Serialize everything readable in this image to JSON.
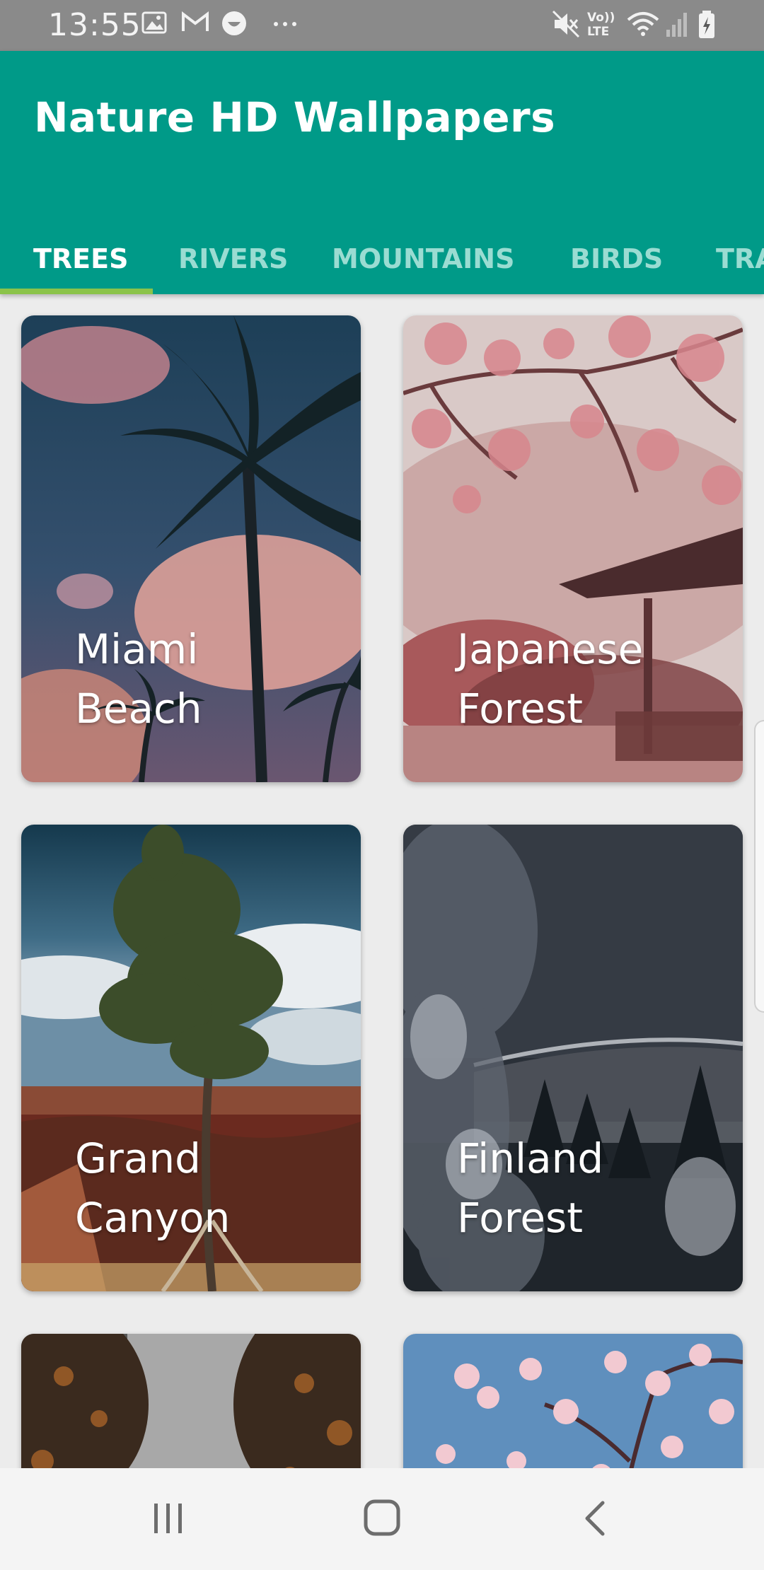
{
  "status_bar": {
    "time": "13:55",
    "icons": [
      "gallery-icon",
      "gmail-icon",
      "emoji-icon",
      "more-dots-icon",
      "mute-icon",
      "volte-icon",
      "wifi-icon",
      "signal-icon",
      "battery-icon"
    ],
    "volte_label": "Vo)\nLTE"
  },
  "app_bar": {
    "title": "Nature HD Wallpapers",
    "color": "#009a88"
  },
  "tabs": [
    {
      "label": "TREES",
      "active": true
    },
    {
      "label": "RIVERS",
      "active": false
    },
    {
      "label": "MOUNTAINS",
      "active": false
    },
    {
      "label": "BIRDS",
      "active": false
    },
    {
      "label": "TRA",
      "active": false
    }
  ],
  "cards": [
    {
      "line1": "Miami",
      "line2": "Beach"
    },
    {
      "line1": "Japanese",
      "line2": "Forest"
    },
    {
      "line1": "Grand",
      "line2": "Canyon"
    },
    {
      "line1": "Finland",
      "line2": "Forest"
    },
    {
      "line1": "",
      "line2": ""
    },
    {
      "line1": "",
      "line2": ""
    }
  ],
  "nav_bar": {
    "icons": [
      "recent-apps-icon",
      "home-icon",
      "back-icon"
    ]
  }
}
